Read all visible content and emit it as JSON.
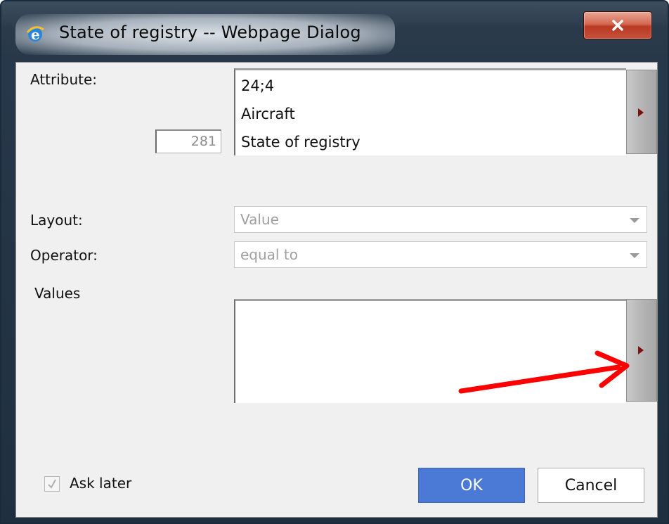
{
  "window": {
    "title": "State of registry -- Webpage Dialog"
  },
  "attribute": {
    "label": "Attribute:",
    "number": "281",
    "lines": [
      "24;4",
      "Aircraft",
      "State of registry"
    ]
  },
  "layout": {
    "label": "Layout:",
    "selected": "Value"
  },
  "operator": {
    "label": "Operator:",
    "selected": "equal to"
  },
  "values": {
    "label": "Values"
  },
  "ask_later": {
    "label": "Ask later",
    "checked": true
  },
  "buttons": {
    "ok": "OK",
    "cancel": "Cancel"
  },
  "colors": {
    "accent_button": "#4a7ad6",
    "annotation_arrow": "#ff0000",
    "expand_triangle": "#7d1010"
  },
  "icons": {
    "app_icon": "internet-explorer-icon",
    "close": "close-icon",
    "expand": "expand-right-icon",
    "dropdown": "chevron-down-icon",
    "check": "check-icon"
  }
}
